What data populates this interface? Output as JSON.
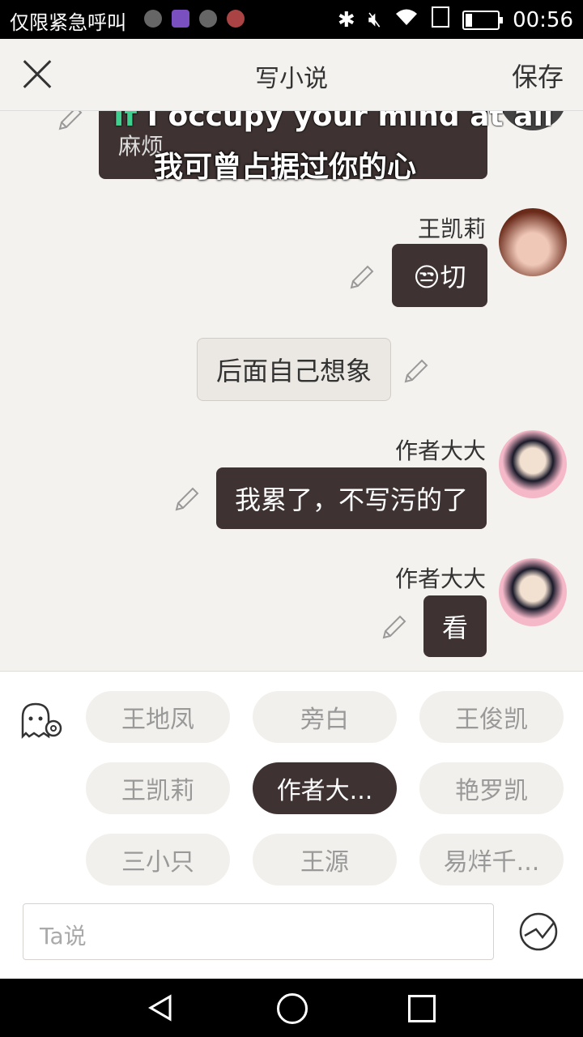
{
  "status_bar": {
    "carrier": "仅限紧急呼叫",
    "time": "00:56",
    "battery_percent": 15
  },
  "header": {
    "title": "写小说",
    "save_label": "保存",
    "close_icon": "close-icon"
  },
  "chat": {
    "overlay_subtitle_en_prefix": "If",
    "overlay_subtitle_en": " I occupy your mind at all",
    "overlay_subtitle_zh": "我可曾占据过你的心",
    "partial_message_line2": "麻烦",
    "messages": [
      {
        "speaker": "王凯莉",
        "text": "😒切"
      },
      {
        "speaker": "",
        "text": "后面自己想象",
        "style": "narration"
      },
      {
        "speaker": "作者大大",
        "text": "我累了，不写污的了"
      },
      {
        "speaker": "作者大大",
        "text": "看"
      }
    ]
  },
  "roles": {
    "chips": [
      "王地凤",
      "旁白",
      "王俊凯",
      "王凯莉",
      "作者大...",
      "艳罗凯",
      "三小只",
      "王源",
      "易烊千..."
    ],
    "selected_index": 4
  },
  "input": {
    "placeholder": "Ta说"
  },
  "colors": {
    "dark_bubble": "#3e3332",
    "background": "#f4f2ee"
  }
}
